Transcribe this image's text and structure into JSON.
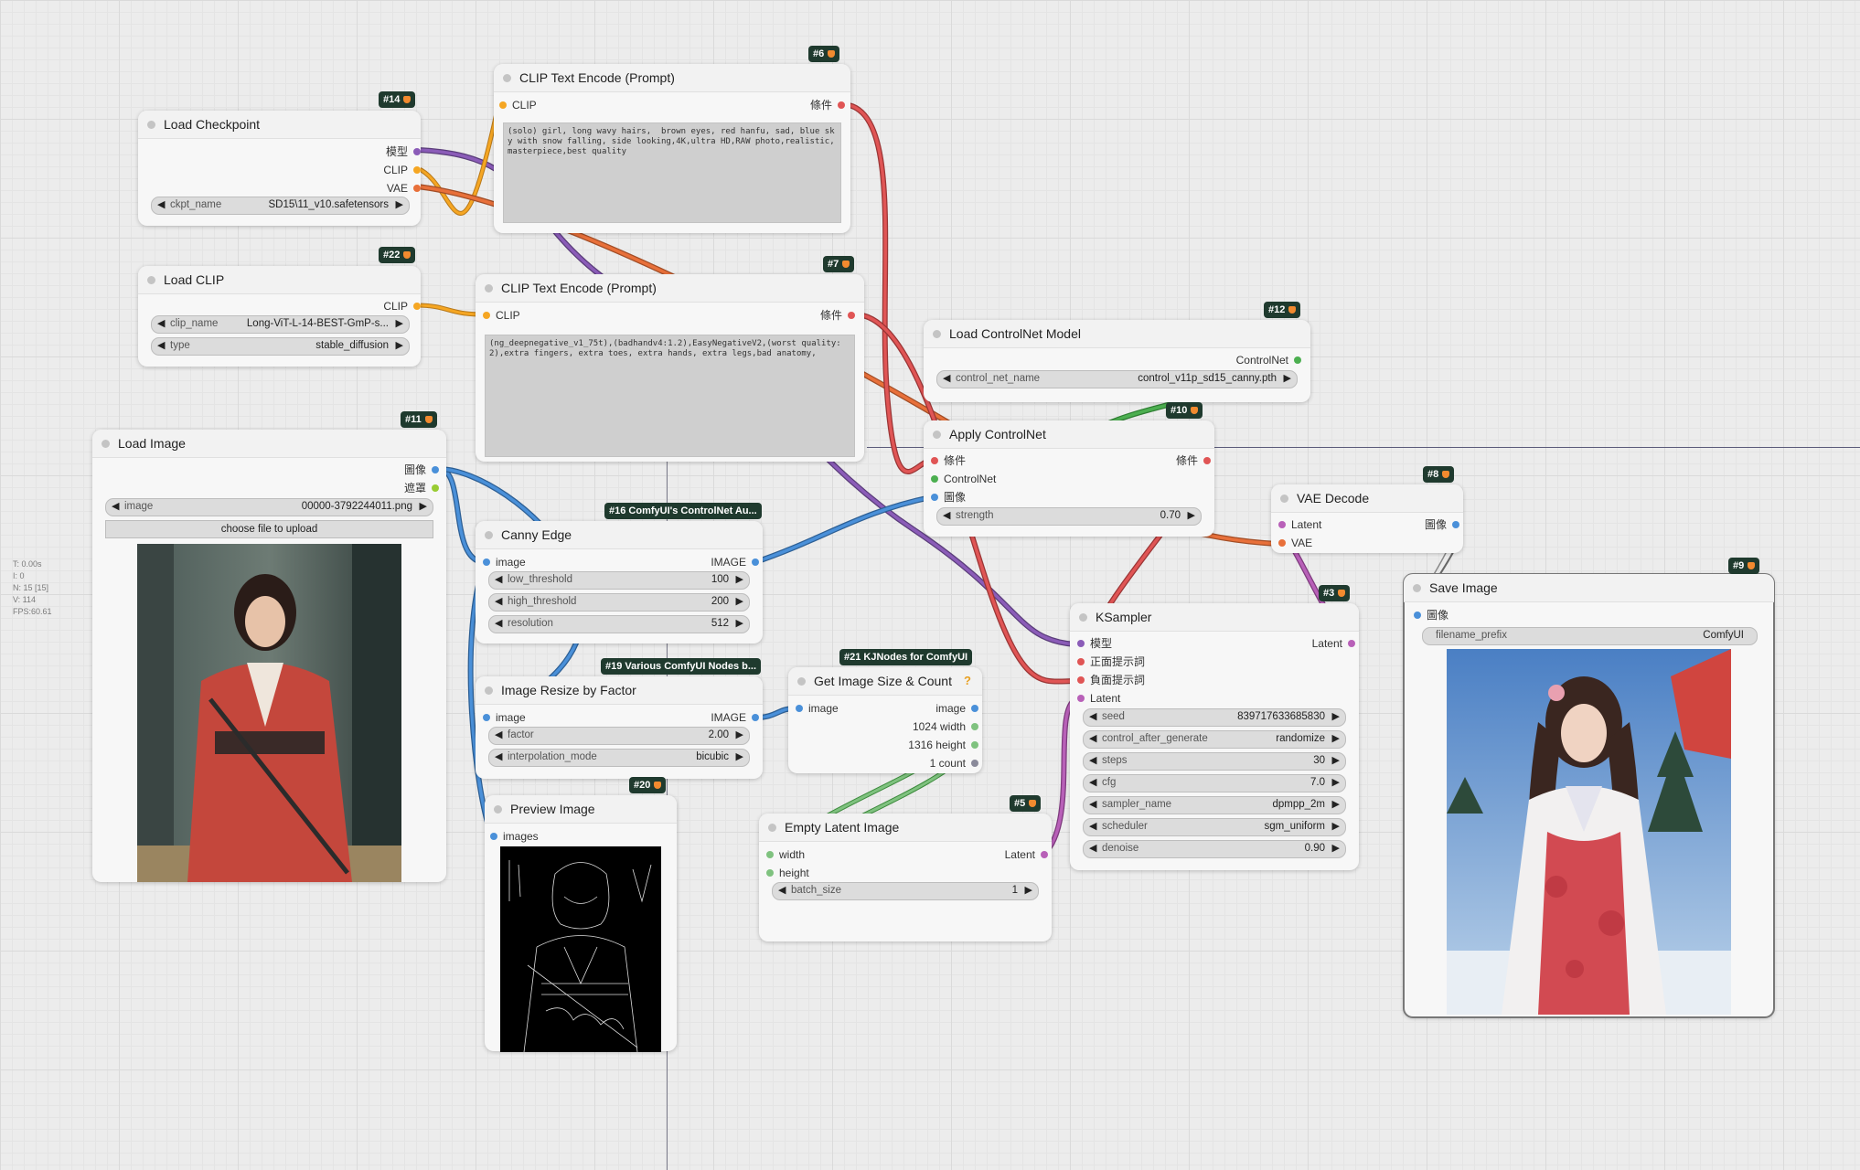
{
  "stats": {
    "lines": [
      "T: 0.00s",
      "I: 0",
      "N: 15 [15]",
      "V: 114",
      "FPS:60.61"
    ]
  },
  "colors": {
    "clip": "#f5a623",
    "model": "#8b5cb8",
    "vae": "#e8703a",
    "conditioning": "#e05555",
    "image": "#4a90d9",
    "mask": "#99cc33",
    "latent": "#b860b8",
    "int": "#7fc27f",
    "controlnet": "#4caf50"
  },
  "nodes": {
    "ckpt": {
      "title": "Load Checkpoint",
      "badge": "#14",
      "out_model": "模型",
      "out_clip": "CLIP",
      "out_vae": "VAE",
      "w_name": "ckpt_name",
      "w_value": "SD15\\11_v10.safetensors"
    },
    "clip": {
      "title": "Load CLIP",
      "badge": "#22",
      "out_clip": "CLIP",
      "w1_name": "clip_name",
      "w1_value": "Long-ViT-L-14-BEST-GmP-s...",
      "w2_name": "type",
      "w2_value": "stable_diffusion"
    },
    "pos": {
      "title": "CLIP Text Encode (Prompt)",
      "badge": "#6",
      "in_clip": "CLIP",
      "out_cond": "條件",
      "text": "(solo) girl, long wavy hairs,  brown eyes, red hanfu, sad, blue sky with snow falling, side looking,4K,ultra HD,RAW photo,realistic,masterpiece,best quality"
    },
    "neg": {
      "title": "CLIP Text Encode (Prompt)",
      "badge": "#7",
      "in_clip": "CLIP",
      "out_cond": "條件",
      "text": "(ng_deepnegative_v1_75t),(badhandv4:1.2),EasyNegativeV2,(worst quality:2),extra fingers, extra toes, extra hands, extra legs,bad anatomy,"
    },
    "loadimg": {
      "title": "Load Image",
      "badge": "#11",
      "out_image": "圖像",
      "out_mask": "遮罩",
      "w_name": "image",
      "w_value": "00000-3792244011.png",
      "upload": "choose file to upload"
    },
    "canny": {
      "title": "Canny Edge",
      "badge": "#16 ComfyUI's ControlNet Au...",
      "in_image": "image",
      "out_image": "IMAGE",
      "w1_name": "low_threshold",
      "w1_value": "100",
      "w2_name": "high_threshold",
      "w2_value": "200",
      "w3_name": "resolution",
      "w3_value": "512"
    },
    "resize": {
      "title": "Image Resize by Factor",
      "badge": "#19 Various ComfyUI Nodes b...",
      "in_image": "image",
      "out_image": "IMAGE",
      "w1_name": "factor",
      "w1_value": "2.00",
      "w2_name": "interpolation_mode",
      "w2_value": "bicubic"
    },
    "getsize": {
      "title": "Get Image Size & Count",
      "badge": "#21 KJNodes for ComfyUI",
      "help": "?",
      "in_image": "image",
      "out_image": "image",
      "out_width": "1024 width",
      "out_height": "1316 height",
      "out_count": "1 count"
    },
    "preview": {
      "title": "Preview Image",
      "badge": "#20",
      "in_images": "images"
    },
    "latent": {
      "title": "Empty Latent Image",
      "badge": "#5",
      "in_width": "width",
      "in_height": "height",
      "out_latent": "Latent",
      "w_name": "batch_size",
      "w_value": "1"
    },
    "cnload": {
      "title": "Load ControlNet Model",
      "badge": "#12",
      "out_cn": "ControlNet",
      "w_name": "control_net_name",
      "w_value": "control_v11p_sd15_canny.pth"
    },
    "apply": {
      "title": "Apply ControlNet",
      "badge": "#10",
      "in_cond": "條件",
      "in_cn": "ControlNet",
      "in_image": "圖像",
      "out_cond": "條件",
      "w_name": "strength",
      "w_value": "0.70"
    },
    "vaedec": {
      "title": "VAE Decode",
      "badge": "#8",
      "in_latent": "Latent",
      "in_vae": "VAE",
      "out_image": "圖像"
    },
    "ksampler": {
      "title": "KSampler",
      "badge": "#3",
      "in_model": "模型",
      "in_pos": "正面提示詞",
      "in_neg": "負面提示詞",
      "in_latent": "Latent",
      "out_latent": "Latent",
      "w1_name": "seed",
      "w1_value": "839717633685830",
      "w2_name": "control_after_generate",
      "w2_value": "randomize",
      "w3_name": "steps",
      "w3_value": "30",
      "w4_name": "cfg",
      "w4_value": "7.0",
      "w5_name": "sampler_name",
      "w5_value": "dpmpp_2m",
      "w6_name": "scheduler",
      "w6_value": "sgm_uniform",
      "w7_name": "denoise",
      "w7_value": "0.90"
    },
    "save": {
      "title": "Save Image",
      "badge": "#9",
      "in_images": "圖像",
      "w_name": "filename_prefix",
      "w_value": "ComfyUI"
    }
  }
}
